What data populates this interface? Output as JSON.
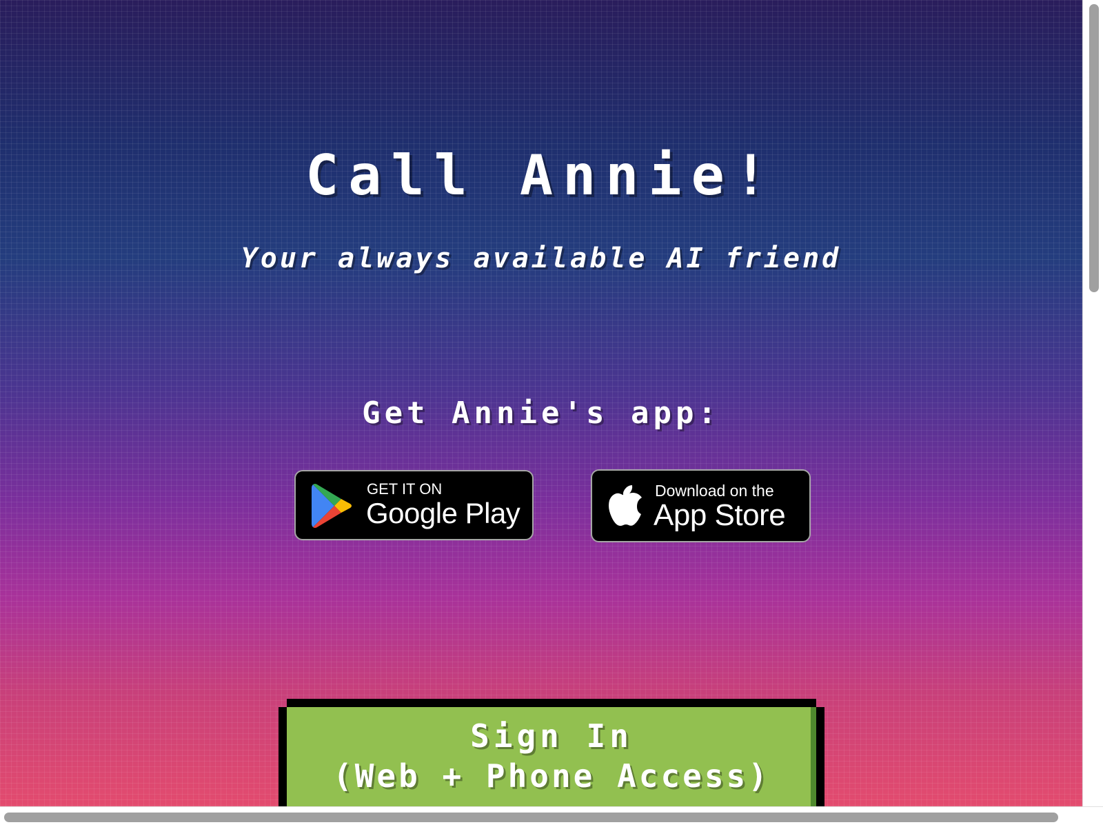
{
  "hero": {
    "title": "Call Annie!",
    "subtitle": "Your always available AI friend"
  },
  "app_section": {
    "heading": "Get Annie's app:",
    "google_play": {
      "small_text": "GET IT ON",
      "big_text": "Google Play",
      "icon": "google-play-icon"
    },
    "app_store": {
      "small_text": "Download on the",
      "big_text": "App Store",
      "icon": "apple-icon"
    }
  },
  "signin": {
    "line1": "Sign In",
    "line2": "(Web + Phone Access)",
    "color": "#92c050"
  },
  "colors": {
    "gradient_top": "#2a1d5c",
    "gradient_bottom": "#e34b6e",
    "text": "#ffffff"
  }
}
